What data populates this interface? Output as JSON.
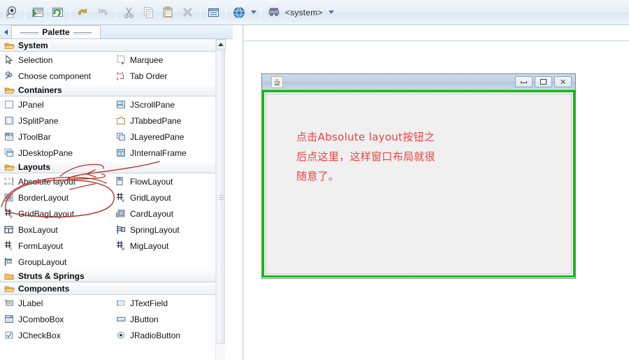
{
  "toolbar": {
    "buttons": [
      {
        "name": "inspect-icon",
        "label": "Inspect"
      },
      {
        "name": "test-run-icon",
        "label": "Test/Preview"
      },
      {
        "name": "refresh-icon",
        "label": "Refresh"
      },
      {
        "name": "undo-icon",
        "label": "Undo"
      },
      {
        "name": "redo-icon",
        "label": "Redo"
      },
      {
        "name": "cut-icon",
        "label": "Cut"
      },
      {
        "name": "copy-icon",
        "label": "Copy"
      },
      {
        "name": "paste-icon",
        "label": "Paste"
      },
      {
        "name": "delete-icon",
        "label": "Delete"
      },
      {
        "name": "layout-properties-icon",
        "label": "Properties"
      },
      {
        "name": "globe-icon",
        "label": "Internationalize"
      }
    ],
    "lookandfeel": {
      "value": "<system>",
      "icon": "laf-icon"
    }
  },
  "palette": {
    "tab_label": "Palette",
    "collapse_icon": "chevron-left-icon",
    "sections": [
      {
        "title": "System",
        "items": [
          {
            "label": "Selection",
            "icon": "cursor-arrow-icon"
          },
          {
            "label": "Marquee",
            "icon": "marquee-icon"
          },
          {
            "label": "Choose component",
            "icon": "choose-component-icon"
          },
          {
            "label": "Tab Order",
            "icon": "tab-order-icon"
          }
        ]
      },
      {
        "title": "Containers",
        "items": [
          {
            "label": "JPanel",
            "icon": "jpanel-icon"
          },
          {
            "label": "JScrollPane",
            "icon": "jscrollpane-icon"
          },
          {
            "label": "JSplitPane",
            "icon": "jsplitpane-icon"
          },
          {
            "label": "JTabbedPane",
            "icon": "jtabbedpane-icon"
          },
          {
            "label": "JToolBar",
            "icon": "jtoolbar-icon"
          },
          {
            "label": "JLayeredPane",
            "icon": "jlayeredpane-icon"
          },
          {
            "label": "JDesktopPane",
            "icon": "jdesktoppane-icon"
          },
          {
            "label": "JInternalFrame",
            "icon": "jinternalframe-icon"
          }
        ]
      },
      {
        "title": "Layouts",
        "items": [
          {
            "label": "Absolute layout",
            "icon": "absolute-layout-icon",
            "highlighted": true
          },
          {
            "label": "FlowLayout",
            "icon": "flowlayout-icon"
          },
          {
            "label": "BorderLayout",
            "icon": "borderlayout-icon"
          },
          {
            "label": "GridLayout",
            "icon": "gridlayout-icon"
          },
          {
            "label": "GridBagLayout",
            "icon": "gridbaglayout-icon"
          },
          {
            "label": "CardLayout",
            "icon": "cardlayout-icon"
          },
          {
            "label": "BoxLayout",
            "icon": "boxlayout-icon"
          },
          {
            "label": "SpringLayout",
            "icon": "springlayout-icon"
          },
          {
            "label": "FormLayout",
            "icon": "formlayout-icon"
          },
          {
            "label": "MigLayout",
            "icon": "miglayout-icon"
          },
          {
            "label": "GroupLayout",
            "icon": "grouplayout-icon"
          }
        ]
      },
      {
        "title": "Struts & Springs",
        "items": []
      },
      {
        "title": "Components",
        "items": [
          {
            "label": "JLabel",
            "icon": "jlabel-icon"
          },
          {
            "label": "JTextField",
            "icon": "jtextfield-icon"
          },
          {
            "label": "JComboBox",
            "icon": "jcombobox-icon"
          },
          {
            "label": "JButton",
            "icon": "jbutton-icon"
          },
          {
            "label": "JCheckBox",
            "icon": "jcheckbox-icon"
          },
          {
            "label": "JRadioButton",
            "icon": "jradiobutton-icon"
          }
        ]
      }
    ],
    "scrollbar": {
      "up_arrow_icon": "scroll-up-icon",
      "thumb_grip_icon": "scroll-grip-icon"
    }
  },
  "canvas": {
    "frame": {
      "app_icon": "java-coffee-cup-icon",
      "title": "",
      "minimize_icon": "minimize-icon",
      "maximize_icon": "maximize-icon",
      "close_icon": "close-icon",
      "content_note": "点击Absolute layout按钮之\n后点这里，这样窗口布局就很\n随意了。",
      "selection_color": "#00c000"
    }
  },
  "annotation": {
    "color": "#c0392b",
    "description": "hand-drawn red ellipse around Absolute layout with arrow"
  }
}
